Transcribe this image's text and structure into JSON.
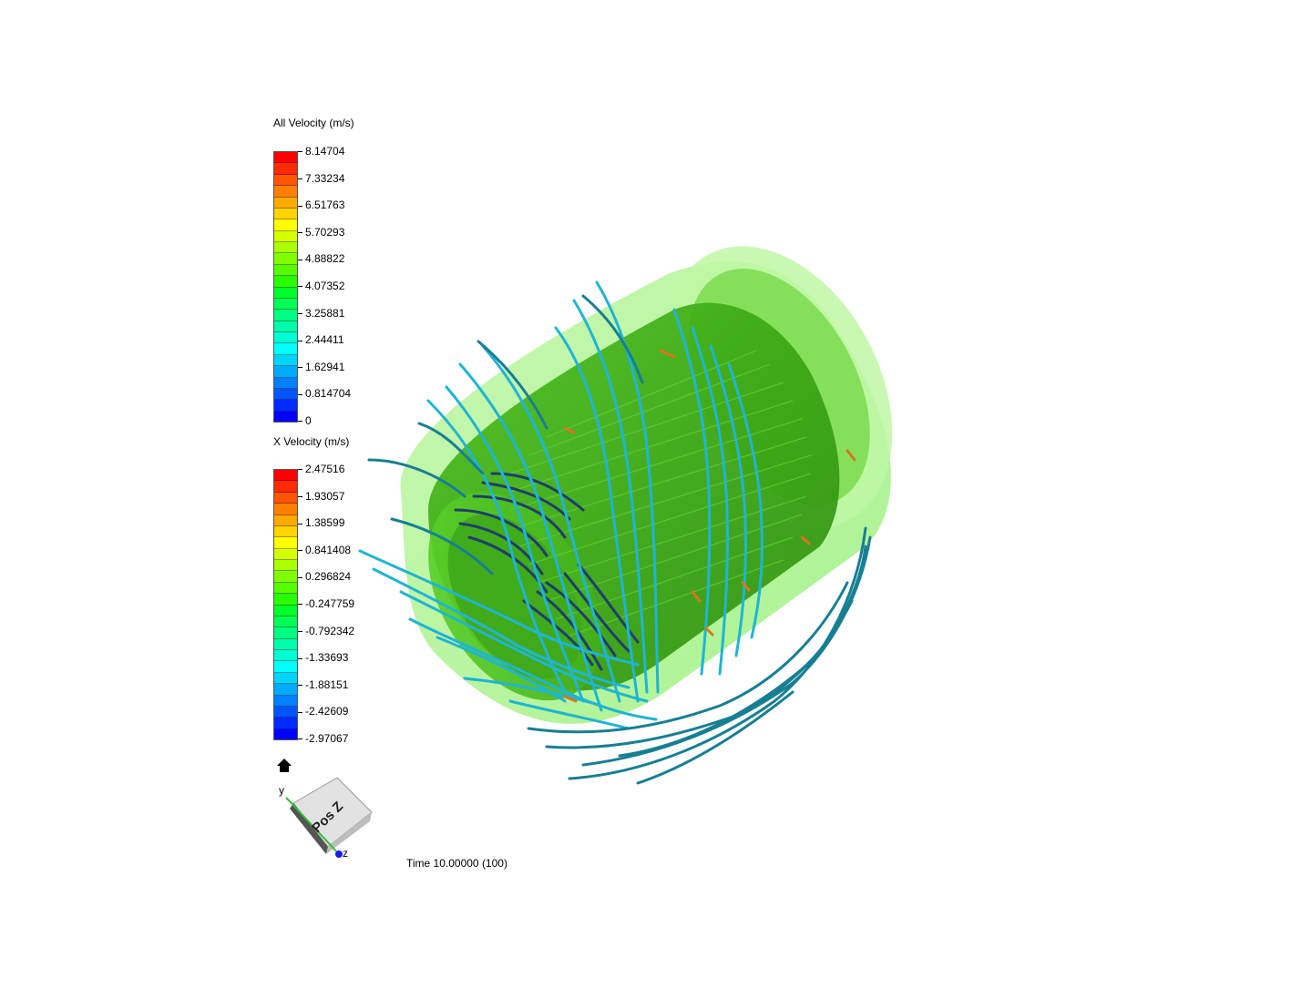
{
  "legends": {
    "all_velocity": {
      "title": "All Velocity (m/s)",
      "ticks": [
        "8.14704",
        "7.33234",
        "6.51763",
        "5.70293",
        "4.88822",
        "4.07352",
        "3.25881",
        "2.44411",
        "1.62941",
        "0.814704",
        "0"
      ]
    },
    "x_velocity": {
      "title": "X Velocity (m/s)",
      "ticks": [
        "2.47516",
        "1.93057",
        "1.38599",
        "0.841408",
        "0.296824",
        "-0.247759",
        "-0.792342",
        "-1.33693",
        "-1.88151",
        "-2.42609",
        "-2.97067"
      ]
    },
    "band_colors": [
      "#ff0000",
      "#ff2a00",
      "#ff5500",
      "#ff8000",
      "#ffaa00",
      "#ffd400",
      "#ffff00",
      "#d4ff00",
      "#aaff00",
      "#80ff00",
      "#55ff00",
      "#2aff00",
      "#00ff2a",
      "#00ff55",
      "#00ff80",
      "#00ffaa",
      "#00ffd4",
      "#00ffff",
      "#00d4ff",
      "#00aaff",
      "#0080ff",
      "#0055ff",
      "#002aff",
      "#0000ff"
    ]
  },
  "orientation": {
    "face_label": "Pos Z",
    "axis_y": "y",
    "axis_z": "z",
    "home_icon": "home-icon"
  },
  "time_label": "Time 10.00000 (100)"
}
